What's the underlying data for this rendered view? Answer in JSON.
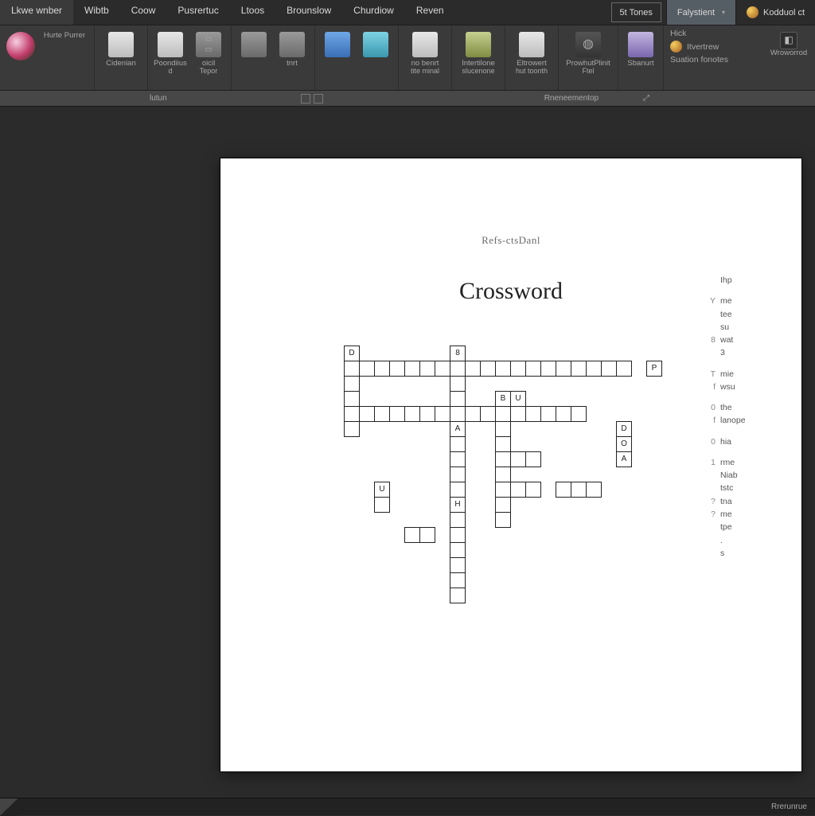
{
  "menu": {
    "tabs": [
      "Lkwe wnber",
      "Wibtb",
      "Coow",
      "Pusrertuc",
      "Ltoos",
      "Brounslow",
      "Churdiow",
      "Reven"
    ],
    "actions": [
      {
        "label": "5t Tones",
        "boxed": true
      },
      {
        "label": "Falystient",
        "hi": true,
        "chev": true
      },
      {
        "label": "Kodduol ct",
        "avatar": true
      }
    ]
  },
  "ribbon": {
    "groups": [
      {
        "items": [
          {
            "label": "Hurte Purrer",
            "icon": "avatar"
          }
        ]
      },
      {
        "items": [
          {
            "label": "Cidenian",
            "icon": "ic-white"
          }
        ]
      },
      {
        "items": [
          {
            "label": "Poondiius",
            "sub": "d",
            "icon": "ic-white"
          },
          {
            "label": "oicil",
            "sub": "Tepor",
            "icon": "ic-gray small"
          }
        ]
      },
      {
        "items": [
          {
            "label": "",
            "icon": "ic-gray"
          },
          {
            "label": "tnrt",
            "icon": "ic-gray"
          }
        ]
      },
      {
        "items": [
          {
            "label": "",
            "icon": "ic-blue"
          },
          {
            "label": "",
            "icon": "ic-teal"
          }
        ]
      },
      {
        "items": [
          {
            "label": "no benrt",
            "sub": "tite minal",
            "icon": "ic-white"
          }
        ]
      },
      {
        "items": [
          {
            "label": "Intertilone",
            "sub": "slucenone",
            "icon": "ic-olive"
          }
        ]
      },
      {
        "items": [
          {
            "label": "Eltrowert",
            "sub": "hut toonth",
            "icon": "ic-white"
          }
        ]
      },
      {
        "items": [
          {
            "label": "ProwhutPlinit",
            "sub": "Ftel",
            "icon": "ic-dark"
          }
        ]
      },
      {
        "items": [
          {
            "label": "Sbanurt",
            "sub": "",
            "icon": "ic-purple"
          }
        ]
      }
    ],
    "sideStack": [
      {
        "label": "Hick"
      },
      {
        "label": "Itvertrew",
        "badge": true
      },
      {
        "label": "Suation fonotes"
      }
    ],
    "farItem": {
      "label": "Wroworrod",
      "icon": "ic-dark"
    }
  },
  "subbar": {
    "left": "lutun",
    "center": "Rneneementop"
  },
  "document": {
    "subtitle": "Refs-ctsDanl",
    "title": "Crossword",
    "clues": [
      {
        "n": "",
        "t": "Ihp"
      },
      {
        "gap": true
      },
      {
        "n": "Y",
        "t": "me"
      },
      {
        "n": "",
        "t": "tee"
      },
      {
        "n": "",
        "t": "su"
      },
      {
        "n": "8",
        "t": "wat"
      },
      {
        "n": "",
        "t": "3"
      },
      {
        "gap": true
      },
      {
        "n": "T",
        "t": "mie"
      },
      {
        "n": "f",
        "t": "wsu"
      },
      {
        "gap": true
      },
      {
        "n": "0",
        "t": "the"
      },
      {
        "n": "f",
        "t": "lanope"
      },
      {
        "gap": true
      },
      {
        "n": "0",
        "t": "hia"
      },
      {
        "gap": true
      },
      {
        "n": "1",
        "t": "rme"
      },
      {
        "n": "",
        "t": "Niab"
      },
      {
        "n": "",
        "t": "tstc"
      },
      {
        "n": "?",
        "t": "tna"
      },
      {
        "n": "?",
        "t": "me"
      },
      {
        "n": "",
        "t": "tpe"
      },
      {
        "n": "",
        "t": "."
      },
      {
        "n": "",
        "t": "s"
      }
    ],
    "crossword": {
      "cols": 21,
      "rows": 18,
      "cells": [
        {
          "r": 0,
          "c": 0,
          "t": "D"
        },
        {
          "r": 0,
          "c": 7,
          "t": "8"
        },
        {
          "r": 1,
          "c": 0
        },
        {
          "r": 1,
          "c": 1
        },
        {
          "r": 1,
          "c": 2
        },
        {
          "r": 1,
          "c": 3
        },
        {
          "r": 1,
          "c": 4
        },
        {
          "r": 1,
          "c": 5
        },
        {
          "r": 1,
          "c": 6
        },
        {
          "r": 1,
          "c": 7
        },
        {
          "r": 1,
          "c": 8
        },
        {
          "r": 1,
          "c": 9
        },
        {
          "r": 1,
          "c": 10
        },
        {
          "r": 1,
          "c": 11
        },
        {
          "r": 1,
          "c": 12
        },
        {
          "r": 1,
          "c": 13
        },
        {
          "r": 1,
          "c": 14
        },
        {
          "r": 1,
          "c": 15
        },
        {
          "r": 1,
          "c": 16
        },
        {
          "r": 1,
          "c": 17
        },
        {
          "r": 1,
          "c": 18
        },
        {
          "r": 1,
          "c": 20,
          "t": "P"
        },
        {
          "r": 2,
          "c": 0
        },
        {
          "r": 2,
          "c": 7
        },
        {
          "r": 3,
          "c": 0
        },
        {
          "r": 3,
          "c": 7
        },
        {
          "r": 3,
          "c": 10,
          "t": "B"
        },
        {
          "r": 3,
          "c": 11,
          "t": "U"
        },
        {
          "r": 4,
          "c": 0
        },
        {
          "r": 4,
          "c": 1
        },
        {
          "r": 4,
          "c": 2
        },
        {
          "r": 4,
          "c": 3
        },
        {
          "r": 4,
          "c": 4
        },
        {
          "r": 4,
          "c": 5
        },
        {
          "r": 4,
          "c": 6
        },
        {
          "r": 4,
          "c": 7
        },
        {
          "r": 4,
          "c": 8
        },
        {
          "r": 4,
          "c": 9
        },
        {
          "r": 4,
          "c": 10
        },
        {
          "r": 4,
          "c": 11
        },
        {
          "r": 4,
          "c": 12
        },
        {
          "r": 4,
          "c": 13
        },
        {
          "r": 4,
          "c": 14
        },
        {
          "r": 4,
          "c": 15
        },
        {
          "r": 5,
          "c": 0
        },
        {
          "r": 5,
          "c": 7,
          "t": "A"
        },
        {
          "r": 5,
          "c": 10
        },
        {
          "r": 5,
          "c": 18,
          "t": "D"
        },
        {
          "r": 6,
          "c": 7
        },
        {
          "r": 6,
          "c": 10
        },
        {
          "r": 6,
          "c": 18,
          "t": "O"
        },
        {
          "r": 7,
          "c": 7
        },
        {
          "r": 7,
          "c": 10
        },
        {
          "r": 7,
          "c": 11
        },
        {
          "r": 7,
          "c": 12
        },
        {
          "r": 7,
          "c": 18,
          "t": "A"
        },
        {
          "r": 8,
          "c": 7
        },
        {
          "r": 8,
          "c": 10
        },
        {
          "r": 9,
          "c": 2,
          "t": "U"
        },
        {
          "r": 9,
          "c": 7
        },
        {
          "r": 9,
          "c": 10
        },
        {
          "r": 9,
          "c": 11
        },
        {
          "r": 9,
          "c": 12
        },
        {
          "r": 9,
          "c": 14
        },
        {
          "r": 9,
          "c": 15
        },
        {
          "r": 9,
          "c": 16
        },
        {
          "r": 10,
          "c": 2
        },
        {
          "r": 10,
          "c": 7,
          "t": "H"
        },
        {
          "r": 10,
          "c": 10
        },
        {
          "r": 11,
          "c": 7
        },
        {
          "r": 11,
          "c": 10
        },
        {
          "r": 12,
          "c": 4
        },
        {
          "r": 12,
          "c": 5
        },
        {
          "r": 12,
          "c": 7
        },
        {
          "r": 13,
          "c": 7
        },
        {
          "r": 14,
          "c": 7
        },
        {
          "r": 15,
          "c": 7
        },
        {
          "r": 16,
          "c": 7
        }
      ]
    }
  },
  "status": {
    "right": "Rrerunrue"
  }
}
